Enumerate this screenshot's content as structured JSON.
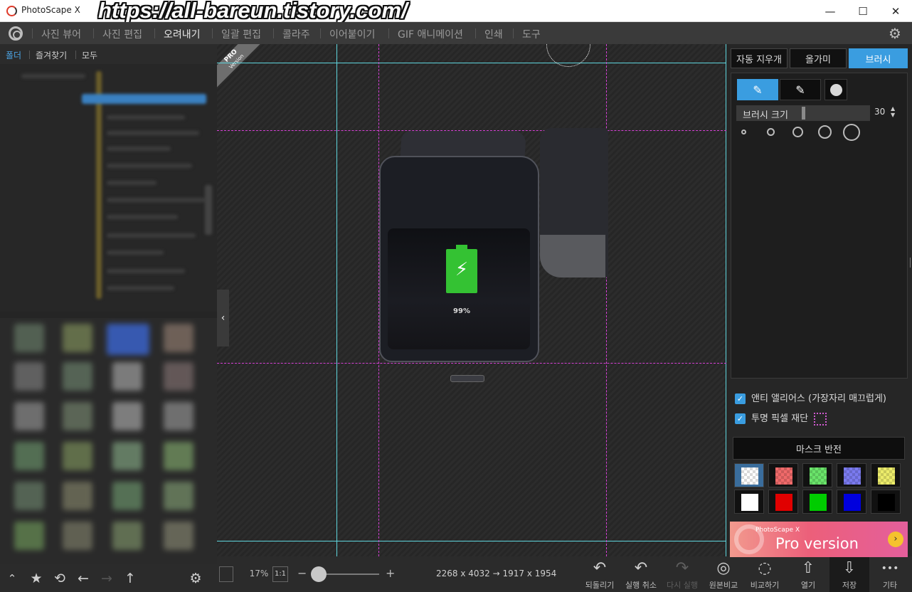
{
  "window": {
    "title": "PhotoScape X",
    "watermark_url": "https://all-bareun.tistory.com/",
    "minimize_glyph": "—",
    "maximize_glyph": "☐",
    "close_glyph": "✕"
  },
  "menu": {
    "items": [
      {
        "label": "사진 뷰어"
      },
      {
        "label": "사진 편집"
      },
      {
        "label": "오려내기"
      },
      {
        "label": "일괄 편집"
      },
      {
        "label": "콜라주"
      },
      {
        "label": "이어붙이기"
      },
      {
        "label": "GIF 애니메이션"
      },
      {
        "label": "인쇄"
      },
      {
        "label": "도구"
      }
    ],
    "active_item": "오려내기",
    "settings_glyph": "⚙"
  },
  "left_panel": {
    "tabs": [
      {
        "label": "폴더"
      },
      {
        "label": "즐겨찾기"
      },
      {
        "label": "모두"
      }
    ],
    "active_tab": "폴더",
    "bottom_icons": [
      {
        "icon": "chevron-up-icon",
        "glyph": "⌃"
      },
      {
        "icon": "star-icon",
        "glyph": "★"
      },
      {
        "icon": "refresh-icon",
        "glyph": "⟲"
      },
      {
        "icon": "arrow-left-icon",
        "glyph": "←"
      },
      {
        "icon": "arrow-right-icon",
        "glyph": "→"
      },
      {
        "icon": "arrow-up-icon",
        "glyph": "↑"
      },
      {
        "icon": "gear-icon",
        "glyph": "⚙"
      }
    ]
  },
  "canvas": {
    "pro_badge": "PRO",
    "pro_badge_sub": "Version",
    "battery_percent": "99%",
    "battery_glyph": "⚡",
    "collapse_glyph": "‹"
  },
  "bottom_toolbar": {
    "zoom_percent": "17%",
    "actual_size_label": "1:1",
    "zoom_minus": "−",
    "zoom_plus": "+",
    "zoom_level": 0.17,
    "image_size": "2268 x 4032 → 1917 x 1954",
    "actions": [
      {
        "label": "되돌리기",
        "glyph": "↶",
        "enabled": true
      },
      {
        "label": "실행 취소",
        "glyph": "↶",
        "enabled": true
      },
      {
        "label": "다시 실행",
        "glyph": "↷",
        "enabled": false
      },
      {
        "label": "원본비교",
        "glyph": "◎",
        "enabled": true
      },
      {
        "label": "비교하기",
        "glyph": "◌",
        "enabled": true
      },
      {
        "label": "열기",
        "glyph": "⇧",
        "enabled": true
      },
      {
        "label": "저장",
        "glyph": "⇩",
        "enabled": true
      },
      {
        "label": "기타",
        "glyph": "•••",
        "enabled": true
      }
    ]
  },
  "right_panel": {
    "tabs": [
      {
        "label": "자동 지우개"
      },
      {
        "label": "올가미"
      },
      {
        "label": "브러시"
      }
    ],
    "active_tab": "브러시",
    "brush_add_glyph": "✎",
    "brush_erase_glyph": "✎",
    "brush_size_label": "브러시 크기",
    "brush_size_value": "30",
    "brush_size_arrows_up": "▲",
    "brush_size_arrows_down": "▼",
    "anti_alias_label": "앤티 앨리어스 (가장자리 매끄럽게)",
    "anti_alias_checked": true,
    "trim_label": "투명 픽셀 재단",
    "trim_checked": true,
    "check_glyph": "✓",
    "mask_invert_label": "마스크 반전",
    "swatches": [
      {
        "color": "#ffffff",
        "checker": true
      },
      {
        "color": "#f06a6a",
        "checker": true
      },
      {
        "color": "#6ae46a",
        "checker": true
      },
      {
        "color": "#7a7aef",
        "checker": true
      },
      {
        "color": "#ecec6a",
        "checker": true
      },
      {
        "color": "#ffffff",
        "checker": false
      },
      {
        "color": "#e00000",
        "checker": false
      },
      {
        "color": "#00cc00",
        "checker": false
      },
      {
        "color": "#0000dd",
        "checker": false
      },
      {
        "color": "#000000",
        "checker": false
      }
    ],
    "ad_small": "PhotoScape X",
    "ad_big": "Pro version",
    "ad_go_glyph": "›"
  },
  "colors": {
    "accent": "#3a9de0",
    "guide_cyan": "#5fd6de",
    "guide_magenta": "#d640d6"
  }
}
